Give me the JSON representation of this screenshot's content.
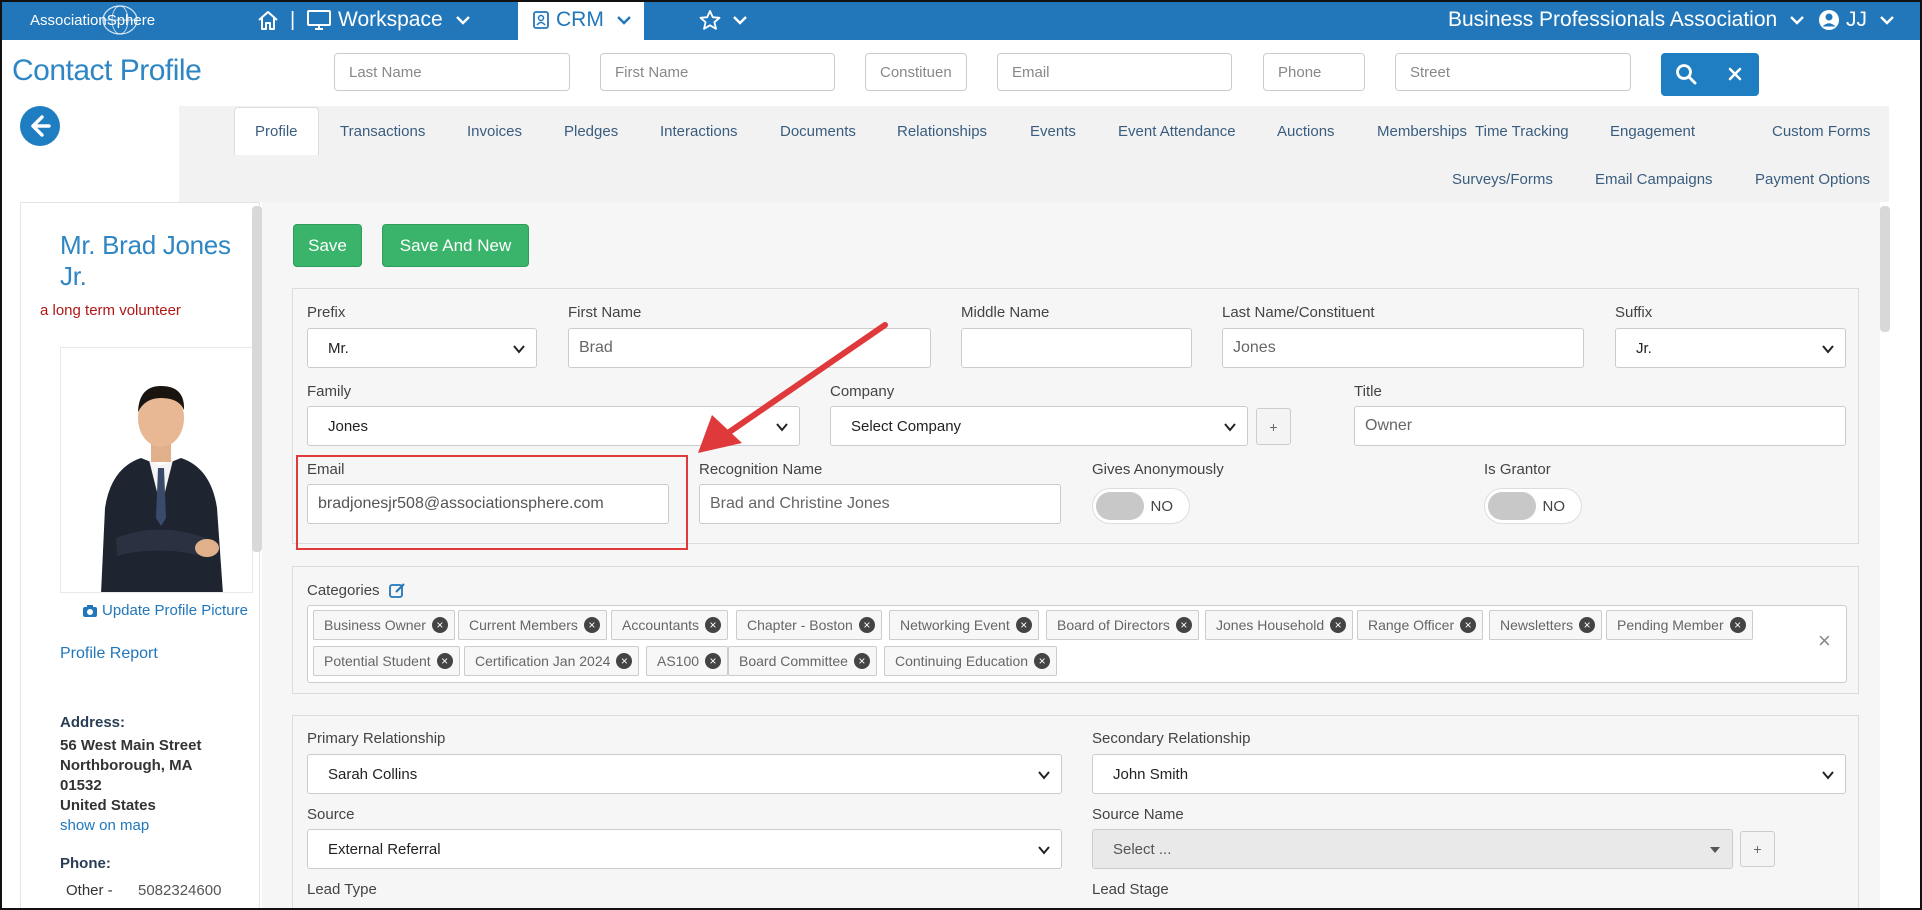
{
  "topbar": {
    "logo": "AssociationSphere",
    "workspace_label": "Workspace",
    "crm_label": "CRM",
    "org_name": "Business Professionals Association",
    "user_initials": "JJ",
    "separator": "|",
    "color": "#2277bb"
  },
  "header": {
    "title": "Contact Profile",
    "search_placeholders": {
      "last_name": "Last Name",
      "first_name": "First Name",
      "constituent": "Constituent",
      "email": "Email",
      "phone": "Phone",
      "street": "Street"
    }
  },
  "tabs": [
    {
      "label": "Profile"
    },
    {
      "label": "Transactions"
    },
    {
      "label": "Invoices"
    },
    {
      "label": "Pledges"
    },
    {
      "label": "Interactions"
    },
    {
      "label": "Documents"
    },
    {
      "label": "Relationships"
    },
    {
      "label": "Events"
    },
    {
      "label": "Event Attendance"
    },
    {
      "label": "Auctions"
    },
    {
      "label": "Memberships"
    },
    {
      "label": "Time Tracking"
    },
    {
      "label": "Engagement"
    },
    {
      "label": "Custom Forms"
    },
    {
      "label": "Surveys/Forms"
    },
    {
      "label": "Email Campaigns"
    },
    {
      "label": "Payment Options"
    }
  ],
  "profile": {
    "name_line1": "Mr. Brad Jones",
    "name_line2": "Jr.",
    "note": "a long term volunteer",
    "update_picture": "Update Profile Picture",
    "profile_report": "Profile Report",
    "address_label": "Address:",
    "address_line1": "56 West Main Street",
    "address_line2": "Northborough, MA",
    "address_line3": "01532",
    "address_line4": "United States",
    "show_on_map": "show on map",
    "phone_label": "Phone:",
    "phone_type": "Other -",
    "phone_number": "5082324600"
  },
  "actions": {
    "save": "Save",
    "save_and_new": "Save And New"
  },
  "form": {
    "prefix_label": "Prefix",
    "prefix_value": "Mr.",
    "first_name_label": "First Name",
    "first_name_value": "Brad",
    "middle_name_label": "Middle Name",
    "middle_name_value": "",
    "last_name_label": "Last Name/Constituent",
    "last_name_value": "Jones",
    "suffix_label": "Suffix",
    "suffix_value": "Jr.",
    "family_label": "Family",
    "family_value": "Jones",
    "company_label": "Company",
    "company_value": "Select Company",
    "company_add": "+",
    "title_label": "Title",
    "title_value": "Owner",
    "email_label": "Email",
    "email_value": "bradjonesjr508@associationsphere.com",
    "recognition_label": "Recognition Name",
    "recognition_value": "Brad and Christine Jones",
    "gives_anon_label": "Gives Anonymously",
    "gives_anon_value": "NO",
    "is_grantor_label": "Is Grantor",
    "is_grantor_value": "NO"
  },
  "categories": {
    "label": "Categories",
    "items": [
      "Business Owner",
      "Current Members",
      "Accountants",
      "Chapter - Boston",
      "Networking Event",
      "Board of Directors",
      "Jones Household",
      "Range Officer",
      "Newsletters",
      "Pending Member",
      "Potential Student",
      "Certification Jan 2024",
      "AS100",
      "Board Committee",
      "Continuing Education"
    ],
    "chip_remove": "×",
    "clear": "×"
  },
  "relationships": {
    "primary_label": "Primary Relationship",
    "primary_value": "Sarah Collins",
    "secondary_label": "Secondary Relationship",
    "secondary_value": "John Smith",
    "source_label": "Source",
    "source_value": "External Referral",
    "source_name_label": "Source Name",
    "source_name_value": "Select ...",
    "source_name_add": "+",
    "lead_type_label": "Lead Type",
    "lead_stage_label": "Lead Stage"
  },
  "annotation": {
    "highlight_color": "#e0393b"
  }
}
